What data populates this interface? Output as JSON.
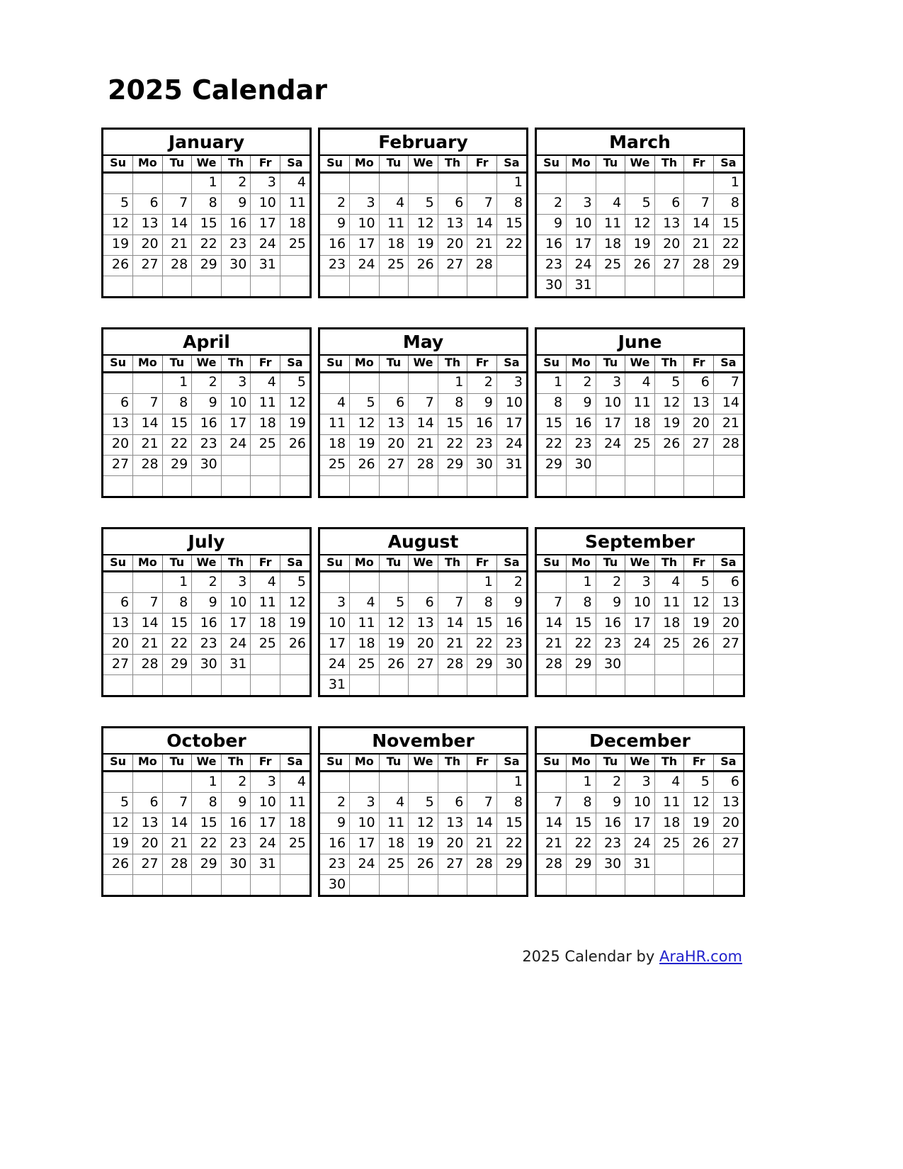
{
  "title": "2025 Calendar",
  "year": "2025",
  "weekday_headers": [
    "Su",
    "Mo",
    "Tu",
    "We",
    "Th",
    "Fr",
    "Sa"
  ],
  "footer": {
    "prefix": "2025  Calendar by ",
    "link_text": "AraHR.com",
    "link_color": "#2222cc"
  },
  "colors": {
    "text": "#000000",
    "background": "#ffffff",
    "block_border": "#000000",
    "grid_line": "#8a8a8a",
    "link": "#2222cc"
  },
  "months": [
    {
      "name": "January",
      "weeks": [
        [
          "",
          "",
          "",
          "1",
          "2",
          "3",
          "4"
        ],
        [
          "5",
          "6",
          "7",
          "8",
          "9",
          "10",
          "11"
        ],
        [
          "12",
          "13",
          "14",
          "15",
          "16",
          "17",
          "18"
        ],
        [
          "19",
          "20",
          "21",
          "22",
          "23",
          "24",
          "25"
        ],
        [
          "26",
          "27",
          "28",
          "29",
          "30",
          "31",
          ""
        ],
        [
          "",
          "",
          "",
          "",
          "",
          "",
          ""
        ]
      ]
    },
    {
      "name": "February",
      "weeks": [
        [
          "",
          "",
          "",
          "",
          "",
          "",
          "1"
        ],
        [
          "2",
          "3",
          "4",
          "5",
          "6",
          "7",
          "8"
        ],
        [
          "9",
          "10",
          "11",
          "12",
          "13",
          "14",
          "15"
        ],
        [
          "16",
          "17",
          "18",
          "19",
          "20",
          "21",
          "22"
        ],
        [
          "23",
          "24",
          "25",
          "26",
          "27",
          "28",
          ""
        ],
        [
          "",
          "",
          "",
          "",
          "",
          "",
          ""
        ]
      ]
    },
    {
      "name": "March",
      "weeks": [
        [
          "",
          "",
          "",
          "",
          "",
          "",
          "1"
        ],
        [
          "2",
          "3",
          "4",
          "5",
          "6",
          "7",
          "8"
        ],
        [
          "9",
          "10",
          "11",
          "12",
          "13",
          "14",
          "15"
        ],
        [
          "16",
          "17",
          "18",
          "19",
          "20",
          "21",
          "22"
        ],
        [
          "23",
          "24",
          "25",
          "26",
          "27",
          "28",
          "29"
        ],
        [
          "30",
          "31",
          "",
          "",
          "",
          "",
          ""
        ]
      ]
    },
    {
      "name": "April",
      "weeks": [
        [
          "",
          "",
          "1",
          "2",
          "3",
          "4",
          "5"
        ],
        [
          "6",
          "7",
          "8",
          "9",
          "10",
          "11",
          "12"
        ],
        [
          "13",
          "14",
          "15",
          "16",
          "17",
          "18",
          "19"
        ],
        [
          "20",
          "21",
          "22",
          "23",
          "24",
          "25",
          "26"
        ],
        [
          "27",
          "28",
          "29",
          "30",
          "",
          "",
          ""
        ],
        [
          "",
          "",
          "",
          "",
          "",
          "",
          ""
        ]
      ]
    },
    {
      "name": "May",
      "weeks": [
        [
          "",
          "",
          "",
          "",
          "1",
          "2",
          "3"
        ],
        [
          "4",
          "5",
          "6",
          "7",
          "8",
          "9",
          "10"
        ],
        [
          "11",
          "12",
          "13",
          "14",
          "15",
          "16",
          "17"
        ],
        [
          "18",
          "19",
          "20",
          "21",
          "22",
          "23",
          "24"
        ],
        [
          "25",
          "26",
          "27",
          "28",
          "29",
          "30",
          "31"
        ],
        [
          "",
          "",
          "",
          "",
          "",
          "",
          ""
        ]
      ]
    },
    {
      "name": "June",
      "weeks": [
        [
          "1",
          "2",
          "3",
          "4",
          "5",
          "6",
          "7"
        ],
        [
          "8",
          "9",
          "10",
          "11",
          "12",
          "13",
          "14"
        ],
        [
          "15",
          "16",
          "17",
          "18",
          "19",
          "20",
          "21"
        ],
        [
          "22",
          "23",
          "24",
          "25",
          "26",
          "27",
          "28"
        ],
        [
          "29",
          "30",
          "",
          "",
          "",
          "",
          ""
        ],
        [
          "",
          "",
          "",
          "",
          "",
          "",
          ""
        ]
      ]
    },
    {
      "name": "July",
      "weeks": [
        [
          "",
          "",
          "1",
          "2",
          "3",
          "4",
          "5"
        ],
        [
          "6",
          "7",
          "8",
          "9",
          "10",
          "11",
          "12"
        ],
        [
          "13",
          "14",
          "15",
          "16",
          "17",
          "18",
          "19"
        ],
        [
          "20",
          "21",
          "22",
          "23",
          "24",
          "25",
          "26"
        ],
        [
          "27",
          "28",
          "29",
          "30",
          "31",
          "",
          ""
        ],
        [
          "",
          "",
          "",
          "",
          "",
          "",
          ""
        ]
      ]
    },
    {
      "name": "August",
      "weeks": [
        [
          "",
          "",
          "",
          "",
          "",
          "1",
          "2"
        ],
        [
          "3",
          "4",
          "5",
          "6",
          "7",
          "8",
          "9"
        ],
        [
          "10",
          "11",
          "12",
          "13",
          "14",
          "15",
          "16"
        ],
        [
          "17",
          "18",
          "19",
          "20",
          "21",
          "22",
          "23"
        ],
        [
          "24",
          "25",
          "26",
          "27",
          "28",
          "29",
          "30"
        ],
        [
          "31",
          "",
          "",
          "",
          "",
          "",
          ""
        ]
      ]
    },
    {
      "name": "September",
      "weeks": [
        [
          "",
          "1",
          "2",
          "3",
          "4",
          "5",
          "6"
        ],
        [
          "7",
          "8",
          "9",
          "10",
          "11",
          "12",
          "13"
        ],
        [
          "14",
          "15",
          "16",
          "17",
          "18",
          "19",
          "20"
        ],
        [
          "21",
          "22",
          "23",
          "24",
          "25",
          "26",
          "27"
        ],
        [
          "28",
          "29",
          "30",
          "",
          "",
          "",
          ""
        ],
        [
          "",
          "",
          "",
          "",
          "",
          "",
          ""
        ]
      ]
    },
    {
      "name": "October",
      "weeks": [
        [
          "",
          "",
          "",
          "1",
          "2",
          "3",
          "4"
        ],
        [
          "5",
          "6",
          "7",
          "8",
          "9",
          "10",
          "11"
        ],
        [
          "12",
          "13",
          "14",
          "15",
          "16",
          "17",
          "18"
        ],
        [
          "19",
          "20",
          "21",
          "22",
          "23",
          "24",
          "25"
        ],
        [
          "26",
          "27",
          "28",
          "29",
          "30",
          "31",
          ""
        ],
        [
          "",
          "",
          "",
          "",
          "",
          "",
          ""
        ]
      ]
    },
    {
      "name": "November",
      "weeks": [
        [
          "",
          "",
          "",
          "",
          "",
          "",
          "1"
        ],
        [
          "2",
          "3",
          "4",
          "5",
          "6",
          "7",
          "8"
        ],
        [
          "9",
          "10",
          "11",
          "12",
          "13",
          "14",
          "15"
        ],
        [
          "16",
          "17",
          "18",
          "19",
          "20",
          "21",
          "22"
        ],
        [
          "23",
          "24",
          "25",
          "26",
          "27",
          "28",
          "29"
        ],
        [
          "30",
          "",
          "",
          "",
          "",
          "",
          ""
        ]
      ]
    },
    {
      "name": "December",
      "weeks": [
        [
          "",
          "1",
          "2",
          "3",
          "4",
          "5",
          "6"
        ],
        [
          "7",
          "8",
          "9",
          "10",
          "11",
          "12",
          "13"
        ],
        [
          "14",
          "15",
          "16",
          "17",
          "18",
          "19",
          "20"
        ],
        [
          "21",
          "22",
          "23",
          "24",
          "25",
          "26",
          "27"
        ],
        [
          "28",
          "29",
          "30",
          "31",
          "",
          "",
          ""
        ],
        [
          "",
          "",
          "",
          "",
          "",
          "",
          ""
        ]
      ]
    }
  ]
}
